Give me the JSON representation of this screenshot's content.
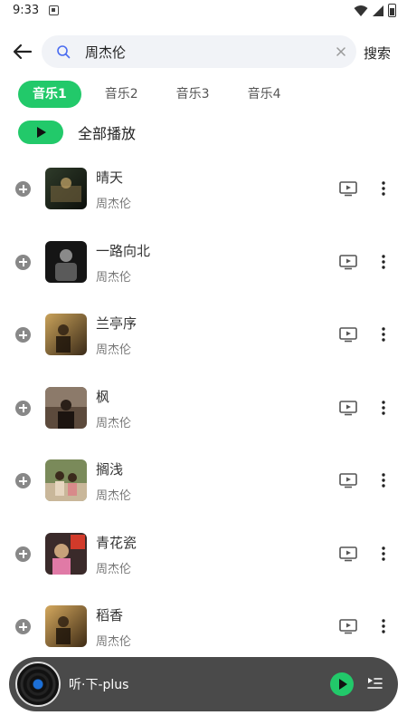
{
  "status_bar": {
    "time": "9:33"
  },
  "search": {
    "query": "周杰伦",
    "action_label": "搜索"
  },
  "tabs": [
    {
      "label": "音乐1",
      "active": true
    },
    {
      "label": "音乐2",
      "active": false
    },
    {
      "label": "音乐3",
      "active": false
    },
    {
      "label": "音乐4",
      "active": false
    }
  ],
  "play_all": {
    "label": "全部播放"
  },
  "songs": [
    {
      "title": "晴天",
      "artist": "周杰伦"
    },
    {
      "title": "一路向北",
      "artist": "周杰伦"
    },
    {
      "title": "兰亭序",
      "artist": "周杰伦"
    },
    {
      "title": "枫",
      "artist": "周杰伦"
    },
    {
      "title": "搁浅",
      "artist": "周杰伦"
    },
    {
      "title": "青花瓷",
      "artist": "周杰伦"
    },
    {
      "title": "稻香",
      "artist": "周杰伦"
    }
  ],
  "mini_player": {
    "title": "听·下-plus"
  },
  "colors": {
    "accent": "#22c96a",
    "player_bg": "#4a4a4a"
  }
}
